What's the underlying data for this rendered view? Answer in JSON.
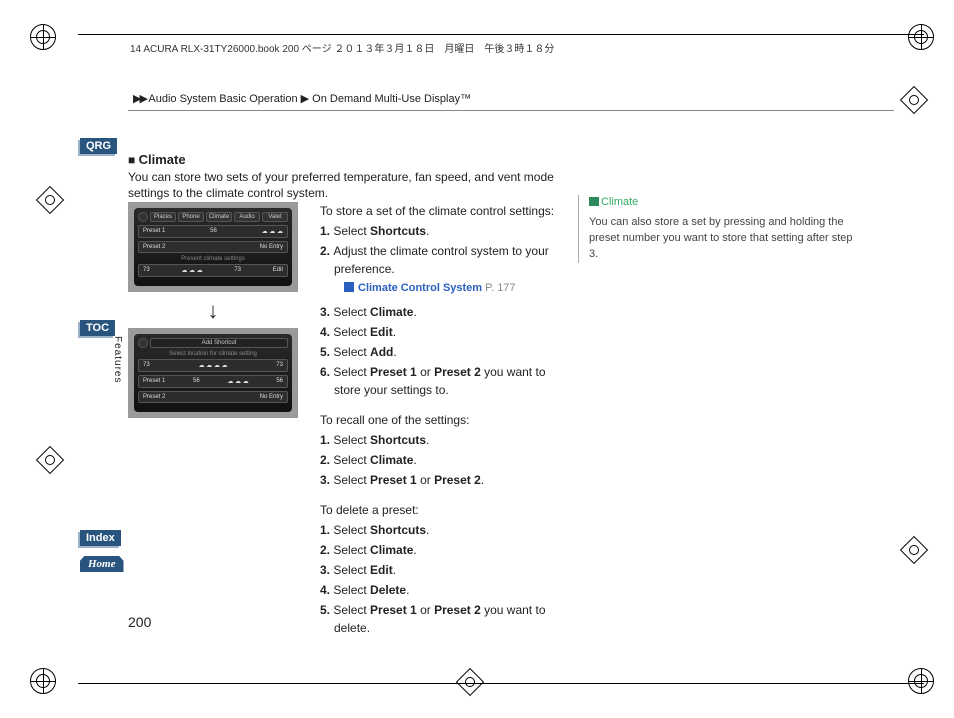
{
  "header": {
    "file_info": "14 ACURA RLX-31TY26000.book  200 ページ  ２０１３年３月１８日　月曜日　午後３時１８分",
    "breadcrumb_arrows": "▶▶",
    "breadcrumb_1": "Audio System Basic Operation",
    "breadcrumb_sep": "▶",
    "breadcrumb_2": "On Demand Multi-Use Display™"
  },
  "nav": {
    "qrg": "QRG",
    "toc": "TOC",
    "index": "Index",
    "home": "Home",
    "side_label": "Features"
  },
  "section": {
    "title": "Climate",
    "intro": "You can store two sets of your preferred temperature, fan speed, and vent mode settings to the climate control system."
  },
  "screen1": {
    "tabs": [
      "Places",
      "Phone",
      "Climate",
      "Audio",
      "Valet"
    ],
    "preset1_label": "Preset 1",
    "preset1_val": "56",
    "preset2_label": "Preset 2",
    "preset2_val": "No Entry",
    "footer_label": "Present climate settings",
    "footer_left": "73",
    "footer_right": "73",
    "edit": "Edit"
  },
  "arrow": "↓",
  "screen2": {
    "title": "Add Shortcut",
    "subtitle": "Select location for climate setting",
    "row1_left": "73",
    "row1_right": "73",
    "preset1_label": "Preset 1",
    "preset1_left": "56",
    "preset1_right": "56",
    "preset2_label": "Preset 2",
    "preset2_val": "No Entry"
  },
  "store": {
    "lead": "To store a set of the climate control settings:",
    "s1_a": "Select ",
    "s1_b": "Shortcuts",
    "s2": "Adjust the climate control system to your preference.",
    "link_text": "Climate Control System",
    "link_page": "P. 177",
    "s3_a": "Select ",
    "s3_b": "Climate",
    "s4_a": "Select ",
    "s4_b": "Edit",
    "s5_a": "Select ",
    "s5_b": "Add",
    "s6_a": "Select ",
    "s6_b": "Preset 1",
    "s6_c": " or ",
    "s6_d": "Preset 2",
    "s6_e": " you want to store your settings to."
  },
  "recall": {
    "lead": "To recall one of the settings:",
    "s1_a": "Select ",
    "s1_b": "Shortcuts",
    "s2_a": "Select ",
    "s2_b": "Climate",
    "s3_a": "Select ",
    "s3_b": "Preset 1",
    "s3_c": " or ",
    "s3_d": "Preset 2"
  },
  "del": {
    "lead": "To delete a preset:",
    "s1_a": "Select ",
    "s1_b": "Shortcuts",
    "s2_a": "Select ",
    "s2_b": "Climate",
    "s3_a": "Select ",
    "s3_b": "Edit",
    "s4_a": "Select ",
    "s4_b": "Delete",
    "s5_a": "Select ",
    "s5_b": "Preset 1",
    "s5_c": " or ",
    "s5_d": "Preset 2",
    "s5_e": " you want to delete."
  },
  "sidebar": {
    "heading": "Climate",
    "body": "You can also store a set by pressing and holding the preset number you want to store that setting after step 3."
  },
  "page_number": "200"
}
